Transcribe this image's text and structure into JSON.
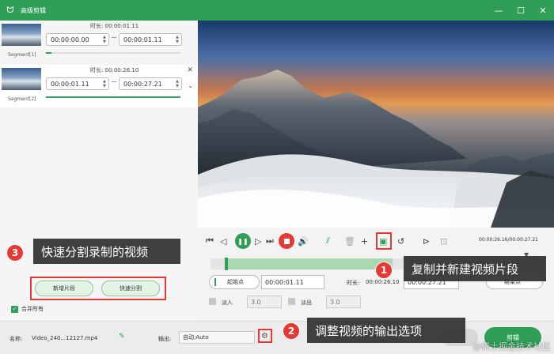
{
  "window": {
    "title": "高级剪辑",
    "icon": "rabbit-logo-icon",
    "accent": "#2f9e57"
  },
  "segments": [
    {
      "label": "Segment[1]",
      "duration_label": "时长: 00:00:01.11",
      "start": "00:00:00.00",
      "end": "00:00:01.11",
      "progress_percent": 4
    },
    {
      "label": "Segment[2]",
      "duration_label": "时长: 00:00:26.10",
      "start": "00:00:01.11",
      "end": "00:00:27.21",
      "progress_percent": 100
    }
  ],
  "player": {
    "timecode": "00:00:26.16/00:00:27.21",
    "timeline_selection_percent": 4,
    "start_button": "起始点",
    "start_time": "00:00:01.11",
    "duration_label": "时长:",
    "duration_value": "00:00:26.10",
    "end_time": "00:00:27.21",
    "end_button": "结束点"
  },
  "fade": {
    "fade_in_label": "淡入",
    "fade_in_value": "3.0",
    "fade_out_label": "淡出",
    "fade_out_value": "3.0"
  },
  "left_actions": {
    "new_segment": "新增片段",
    "quick_split": "快速分割",
    "merge_all": "合并所有"
  },
  "bottom": {
    "name_label": "名称:",
    "file_name": "Video_240...12127.mp4",
    "output_label": "输出:",
    "output_value": "自动;Auto",
    "cut_button": "剪辑"
  },
  "callouts": {
    "c1": {
      "num": "1",
      "text": "复制并新建视频片段"
    },
    "c2": {
      "num": "2",
      "text": "调整视频的输出选项"
    },
    "c3": {
      "num": "3",
      "text": "快速分割录制的视频"
    }
  },
  "watermark": "@稀土掘金技术社区"
}
